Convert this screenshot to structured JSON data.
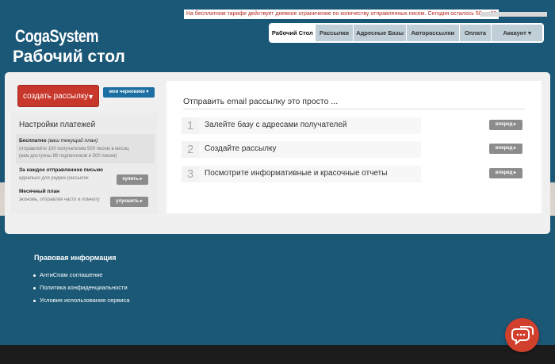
{
  "header": {
    "limit_notice": "На бесплатном тарифе действует дневное ограничение по количеству отправленных писем. Сегодня осталось 50 из 50",
    "logo": "CogaSystem",
    "page_title": "Рабочий стол"
  },
  "nav": {
    "tabs": [
      {
        "label": "Рабочий Стол",
        "active": true
      },
      {
        "label": "Рассылки",
        "active": false
      },
      {
        "label": "Адресные Базы",
        "active": false
      },
      {
        "label": "Авторассылки",
        "active": false
      },
      {
        "label": "Оплата",
        "active": false
      },
      {
        "label": "Аккаунт ▾",
        "active": false
      }
    ]
  },
  "actions": {
    "create_label": "создать рассылку",
    "create_caret": "▼",
    "drafts_label": "мои черновики ▾"
  },
  "payments": {
    "title": "Настройки платежей",
    "plans": [
      {
        "name": "Бесплатно",
        "note": "(ваш текущий план)",
        "desc": "отправляйте 100 получателям 500 писем в месяц",
        "desc2": "(вам доступны 89 подписчиков и 500 писем)"
      },
      {
        "name": "За каждое отправленное письмо",
        "desc": "идеально для редких рассылок",
        "button": "купить ▸"
      },
      {
        "name": "Месячный план",
        "desc": "экономь, отправляя часто и помногу",
        "button": "улучшить ▸"
      }
    ]
  },
  "steps": {
    "title": "Отправить email рассылку это просто ...",
    "items": [
      {
        "num": "1",
        "text": "Залейте базу с адресами получателей",
        "button": "вперед ▸"
      },
      {
        "num": "2",
        "text": "Создайте рассылку",
        "button": "вперед ▸"
      },
      {
        "num": "3",
        "text": "Посмотрите информативные и красочные отчеты",
        "button": "вперед ▸"
      }
    ]
  },
  "footer": {
    "title": "Правовая информация",
    "links": [
      "АнтиСпам соглашение",
      "Политика конфиденциальности",
      "Условия использования сервиса"
    ]
  },
  "colors": {
    "brand_blue": "#1b5877",
    "create_red": "#c8372b",
    "chat_red": "#d1402d"
  }
}
